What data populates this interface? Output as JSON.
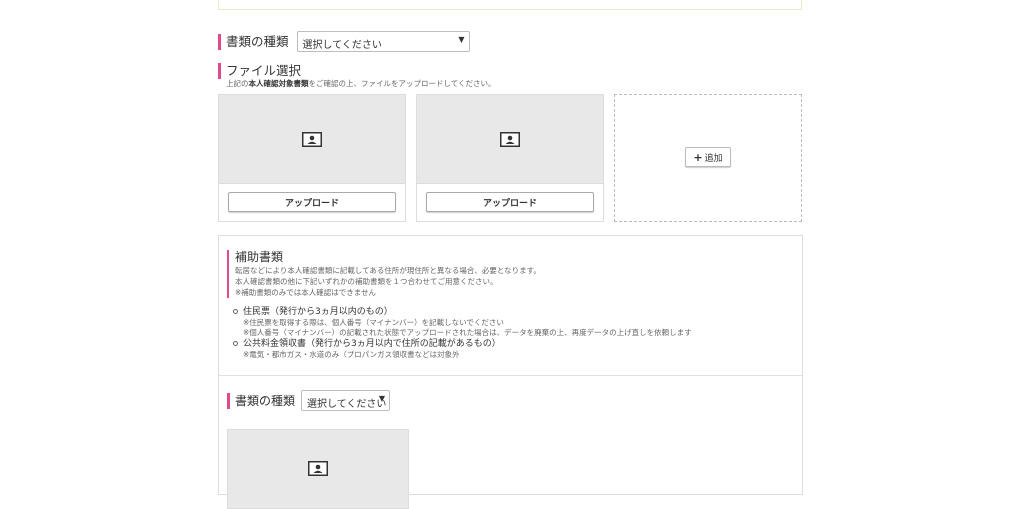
{
  "document_type": {
    "label": "書類の種類",
    "select_value": "選択してください"
  },
  "file_select": {
    "title": "ファイル選択",
    "desc_prefix": "上記の",
    "desc_bold": "本人確認対象書類",
    "desc_suffix": "をご確認の上、ファイルをアップロードしてください。",
    "cards": [
      {
        "icon": "id-card-icon",
        "button": "アップロード"
      },
      {
        "icon": "id-card-icon",
        "button": "アップロード"
      }
    ],
    "add_button": {
      "icon": "plus-icon",
      "label": "追加"
    }
  },
  "auxiliary": {
    "title": "補助書類",
    "lines": [
      "転居などにより本人確認書類に記載してある住所が現住所と異なる場合、必要となります。",
      "本人確認書類の他に下記いずれかの補助書類を１つ合わせてご用意ください。",
      "※補助書類のみでは本人確認はできません"
    ],
    "items": [
      {
        "title": "住民票（発行から3ヵ月以内のもの）",
        "notes": [
          "※住民票を取得する際は、個人番号（マイナンバー）を記載しないでください",
          "※個人番号（マイナンバー）の記載された状態でアップロードされた場合は、データを廃棄の上、再度データの上げ直しを依頼します"
        ]
      },
      {
        "title": "公共料金領収書（発行から3ヵ月以内で住所の記載があるもの）",
        "notes": [
          "※電気・都市ガス・水道のみ（プロパンガス領収書などは対象外"
        ]
      }
    ],
    "document_type": {
      "label": "書類の種類",
      "select_value": "選択してください"
    },
    "card_icon": "id-card-icon"
  },
  "colors": {
    "accent": "#e2498a",
    "placeholder_bg": "#e8e8e8",
    "border": "#dddddd"
  }
}
